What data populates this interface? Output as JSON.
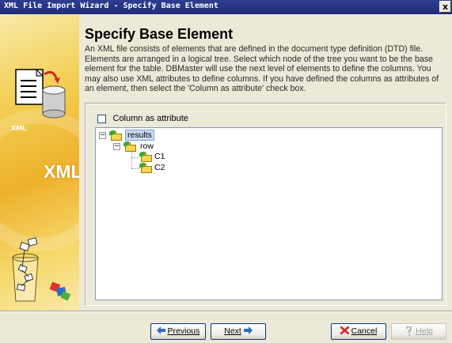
{
  "window": {
    "title": "XML File Import Wizard - Specify Base Element",
    "close_label": "x"
  },
  "banner": {
    "doc_label": "XML",
    "big_label": "XML"
  },
  "header": {
    "title": "Specify Base Element",
    "description": "An XML file consists of elements that are defined in the document type definition (DTD) file. Elements are arranged in a logical tree. Select which node of the tree you want to be the base element for the table. DBMaster will use the next level of elements to define the columns. You may also use XML attributes to define columns. If you have defined the columns as attributes of an element, then select the 'Column as attribute' check box."
  },
  "options": {
    "column_as_attribute_label": "Column as attribute",
    "column_as_attribute_checked": false
  },
  "tree": {
    "root": {
      "label": "results",
      "expanded": true,
      "selected": true
    },
    "child": {
      "label": "row",
      "expanded": true
    },
    "leaves": [
      "C1",
      "C2"
    ],
    "collapse_symbol": "−"
  },
  "buttons": {
    "previous": "Previous",
    "next": "Next",
    "cancel": "Cancel",
    "help": "Help"
  },
  "icons": {
    "previous": "arrow-left-icon",
    "next": "arrow-right-icon",
    "cancel": "x-icon",
    "help": "question-icon"
  },
  "colors": {
    "titlebar": "#1f2c78",
    "banner": "#eeb12c",
    "selection": "#c9daf2",
    "folder": "#f5d54b",
    "cancel_icon": "#d12a2a",
    "arrow_icon": "#2b6cc4"
  }
}
